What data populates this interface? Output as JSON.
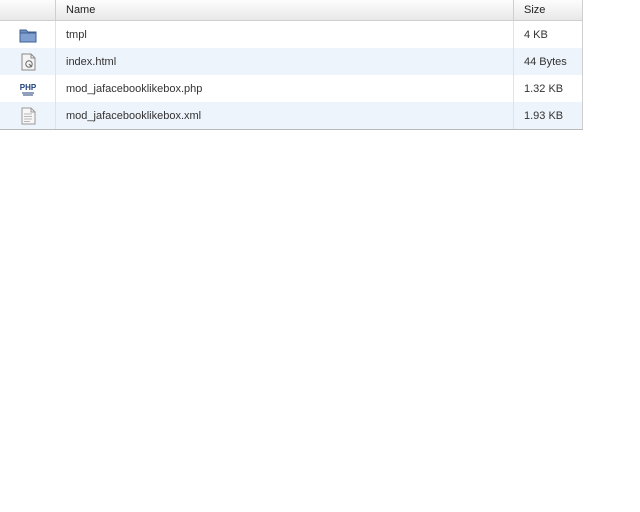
{
  "columns": {
    "icon": "",
    "name": "Name",
    "size": "Size"
  },
  "files": [
    {
      "icon": "folder-icon",
      "name": "tmpl",
      "size": "4 KB"
    },
    {
      "icon": "html-file-icon",
      "name": "index.html",
      "size": "44 Bytes"
    },
    {
      "icon": "php-file-icon",
      "name": "mod_jafacebooklikebox.php",
      "size": "1.32 KB"
    },
    {
      "icon": "document-file-icon",
      "name": "mod_jafacebooklikebox.xml",
      "size": "1.93 KB"
    }
  ],
  "colors": {
    "header_bg": "#ececec",
    "alt_row_bg": "#eef4fb",
    "folder_blue": "#5b7fb5"
  }
}
